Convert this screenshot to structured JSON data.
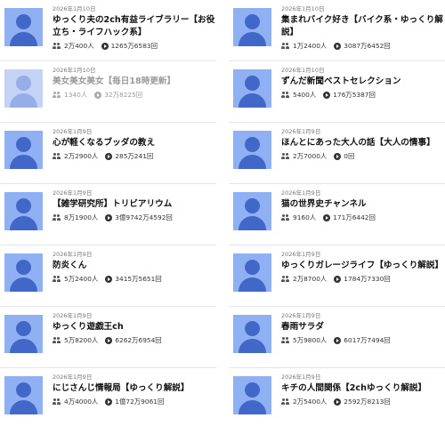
{
  "channels": [
    {
      "date": "2026年1月10日",
      "title": "ゆっくり夫の2ch有益ライブラリー【お役立ち・ライフハック系】",
      "subscribers": "2万400人",
      "views": "1265万6583回",
      "muted": false
    },
    {
      "date": "2026年1月10日",
      "title": "集まれバイク好き【バイク系・ゆっくり解説】",
      "subscribers": "1万2400人",
      "views": "3087万6452回",
      "muted": false
    },
    {
      "date": "2026年1月10日",
      "title": "美女美女美女【毎日18時更新】",
      "subscribers": "1340人",
      "views": "32万8225回",
      "muted": true
    },
    {
      "date": "2026年1月10日",
      "title": "ずんだ新聞ベストセレクション",
      "subscribers": "5400人",
      "views": "176万5387回",
      "muted": false
    },
    {
      "date": "2026年1月9日",
      "title": "心が軽くなるブッダの教え",
      "subscribers": "2万2900人",
      "views": "285万241回",
      "muted": false
    },
    {
      "date": "2026年1月9日",
      "title": "ほんとにあった大人の話【大人の情事】",
      "subscribers": "2万7000人",
      "views": "0回",
      "muted": false
    },
    {
      "date": "2026年1月9日",
      "title": "【雑学研究所】トリビアリウム",
      "subscribers": "8万1900人",
      "views": "3億9742万4592回",
      "muted": false
    },
    {
      "date": "2026年1月9日",
      "title": "猫の世界史チャンネル",
      "subscribers": "9160人",
      "views": "171万6442回",
      "muted": false
    },
    {
      "date": "2026年1月9日",
      "title": "防炎くん",
      "subscribers": "5万2400人",
      "views": "3415万5651回",
      "muted": false
    },
    {
      "date": "2026年1月9日",
      "title": "ゆっくりガレージライフ【ゆっくり解説】",
      "subscribers": "2万8700人",
      "views": "1784万7330回",
      "muted": false
    },
    {
      "date": "2026年1月9日",
      "title": "ゆっくり遊戯王ch",
      "subscribers": "5万8200人",
      "views": "6262万6954回",
      "muted": false
    },
    {
      "date": "2026年1月9日",
      "title": "春雨サラダ",
      "subscribers": "5万9800人",
      "views": "6017万7494回",
      "muted": false
    },
    {
      "date": "2026年1月9日",
      "title": "にじさんじ情報局【ゆっくり解説】",
      "subscribers": "4万4000人",
      "views": "1億72万9061回",
      "muted": false
    },
    {
      "date": "2026年1月9日",
      "title": "キチの人間関係【2chゆっくり解説】",
      "subscribers": "2万5400人",
      "views": "2592万8213回",
      "muted": false
    }
  ],
  "icons": {
    "avatar": "default-user-avatar",
    "subscribers": "people-icon",
    "views": "play-circle-icon"
  },
  "colors": {
    "avatar_bg": "#8fb0f2",
    "avatar_fg": "#4168c9",
    "muted_text": "#9a9a9a"
  }
}
